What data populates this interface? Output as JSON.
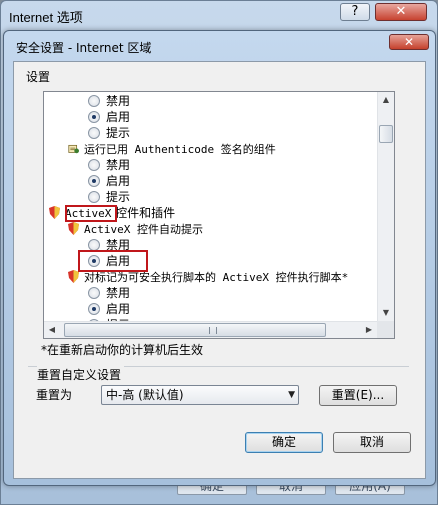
{
  "outer": {
    "title": "Internet 选项",
    "help": "?",
    "close": "✕",
    "bottom_buttons": [
      "确定",
      "取消",
      "应用(A)"
    ]
  },
  "dialog": {
    "title": "安全设置 - Internet 区域",
    "close": "✕",
    "settings_label": "设置",
    "tree": [
      {
        "label": "禁用",
        "type": "radio",
        "checked": false
      },
      {
        "label": "启用",
        "type": "radio",
        "checked": true
      },
      {
        "label": "提示",
        "type": "radio",
        "checked": false
      },
      {
        "label": "运行已用 Authenticode 签名的组件",
        "type": "group"
      },
      {
        "label": "禁用",
        "type": "radio",
        "checked": false
      },
      {
        "label": "启用",
        "type": "radio",
        "checked": true
      },
      {
        "label": "提示",
        "type": "radio",
        "checked": false
      },
      {
        "label_prefix": "ActiveX",
        "label": " 控件和插件",
        "type": "category"
      },
      {
        "label": "ActiveX 控件自动提示",
        "type": "setting"
      },
      {
        "label": "禁用",
        "type": "radio",
        "checked": false
      },
      {
        "label": "启用",
        "type": "radio",
        "checked": true
      },
      {
        "label": "对标记为可安全执行脚本的 ActiveX 控件执行脚本*",
        "type": "setting"
      },
      {
        "label": "禁用",
        "type": "radio",
        "checked": false
      },
      {
        "label": "启用",
        "type": "radio",
        "checked": true
      },
      {
        "label": "提示",
        "type": "radio",
        "checked": false
      }
    ],
    "note": "*在重新启动你的计算机后生效",
    "reset_group_label": "重置自定义设置",
    "reset_to_label": "重置为",
    "reset_level": "中-高 (默认值)",
    "reset_button": "重置(E)...",
    "ok_button": "确定",
    "cancel_button": "取消"
  },
  "colors": {
    "highlight_red": "#c0171b",
    "title_bar": "#b8cfe8",
    "close_red": "#c5402c"
  },
  "icons": [
    "shield-icon",
    "certificate-icon",
    "chevron-up-icon",
    "chevron-down-icon",
    "chevron-left-icon",
    "chevron-right-icon",
    "dropdown-arrow-icon"
  ]
}
